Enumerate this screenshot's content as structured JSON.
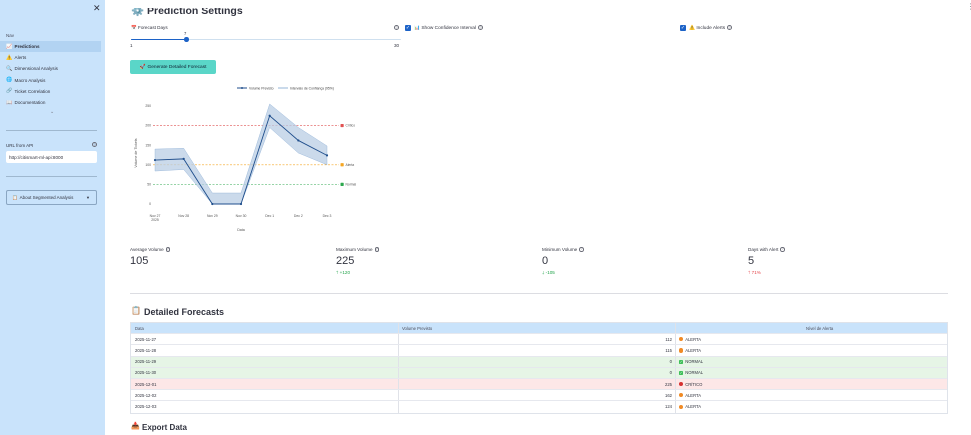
{
  "sidebar": {
    "nav_heading": "Nav",
    "items": [
      {
        "label": "Predictions",
        "icon": "📈"
      },
      {
        "label": "Alerts",
        "icon": "⚠️"
      },
      {
        "label": "Dimensional Analysis",
        "icon": "🔍"
      },
      {
        "label": "Macro Analysis",
        "icon": "🌐"
      },
      {
        "label": "Ticket Correlation",
        "icon": "🔗"
      },
      {
        "label": "Documentation",
        "icon": "📖"
      }
    ],
    "api_label": "URL from API",
    "api_value": "http://citismart-ml-api:8000",
    "expander_label": "About Segmented Analysis",
    "expander_icon": "📋"
  },
  "main": {
    "prediction_title": "Prediction Settings",
    "prediction_icon": "⚙️",
    "forecast_days_label": "Forecast Days",
    "forecast_days_icon": "📅",
    "forecast_days_value": "7",
    "forecast_days_min": "1",
    "forecast_days_max": "30",
    "show_ci_label": "Show Confidence Interval",
    "show_ci_icon": "📊",
    "include_alerts_label": "Include Alerts",
    "include_alerts_icon": "⚠️",
    "generate_button": "Generate Detailed Forecast",
    "generate_icon": "🚀"
  },
  "chart_data": {
    "type": "line",
    "legend": [
      "Volume Previsto",
      "Intervalo de Confiança (95%)"
    ],
    "legend_position": "top",
    "xlabel": "Data",
    "ylabel": "Volume de Tickets",
    "x": [
      "Nov 27\n2025",
      "Nov 28",
      "Nov 29",
      "Nov 30",
      "Dec 1",
      "Dec 2",
      "Dec 3"
    ],
    "y_ticks": [
      0,
      50,
      100,
      150,
      200,
      250
    ],
    "ylim": [
      0,
      260
    ],
    "series": [
      {
        "name": "Volume Previsto",
        "values": [
          112,
          115,
          0,
          0,
          225,
          162,
          124
        ],
        "upper": [
          140,
          142,
          28,
          28,
          255,
          195,
          148
        ],
        "lower": [
          84,
          88,
          0,
          0,
          195,
          130,
          100
        ]
      }
    ],
    "thresholds": [
      {
        "label": "Crítico",
        "value": 200,
        "color": "#e05252"
      },
      {
        "label": "Alerta",
        "value": 100,
        "color": "#f5a623"
      },
      {
        "label": "Normal",
        "value": 50,
        "color": "#2ea84f"
      }
    ],
    "line_color": "#1f4e8c",
    "band_color": "#b9cde4",
    "grid": false
  },
  "metrics": [
    {
      "label": "Average Volume",
      "value": "105",
      "delta": ""
    },
    {
      "label": "Maximum Volume",
      "value": "225",
      "delta": "+120"
    },
    {
      "label": "Minimum Volume",
      "value": "0",
      "delta": "-105"
    },
    {
      "label": "Days with Alert",
      "value": "5",
      "delta": "71%"
    }
  ],
  "detailed": {
    "title": "Detailed Forecasts",
    "icon": "📋",
    "columns": [
      "Data",
      "Volume Previsto",
      "Nível de Alerta"
    ],
    "rows": [
      {
        "date": "2025-11-27",
        "volume": "112",
        "level": "ALERTA",
        "kind": "alerta"
      },
      {
        "date": "2025-11-28",
        "volume": "115",
        "level": "ALERTA",
        "kind": "alerta"
      },
      {
        "date": "2025-11-29",
        "volume": "0",
        "level": "NORMAL",
        "kind": "normal"
      },
      {
        "date": "2025-11-30",
        "volume": "0",
        "level": "NORMAL",
        "kind": "normal"
      },
      {
        "date": "2025-12-01",
        "volume": "225",
        "level": "CRÍTICO",
        "kind": "critico"
      },
      {
        "date": "2025-12-02",
        "volume": "162",
        "level": "ALERTA",
        "kind": "alerta"
      },
      {
        "date": "2025-12-03",
        "volume": "124",
        "level": "ALERTA",
        "kind": "alerta"
      }
    ]
  },
  "export": {
    "title": "Export Data",
    "icon": "📥"
  }
}
